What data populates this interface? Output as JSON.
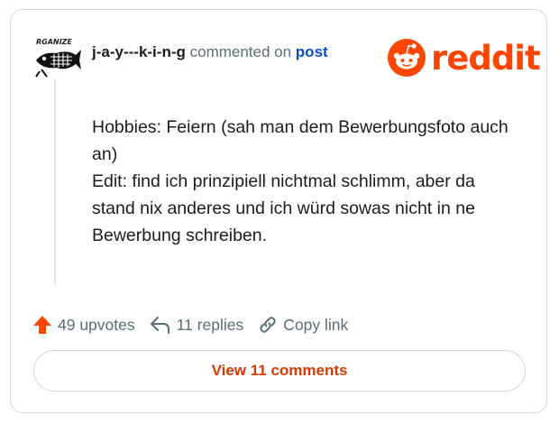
{
  "comment": {
    "avatar_text": "RGANIZE",
    "username": "j-a-y---k-i-n-g",
    "commented_on": "commented on",
    "post_link": "post",
    "lines": [
      "Hobbies: Feiern (sah man dem Bewerbungsfoto auch an)",
      "Edit: find ich prinzipiell nichtmal schlimm, aber da stand nix anderes und ich würd sowas nicht in ne Bewerbung schreiben."
    ]
  },
  "brand": {
    "logo_text": "reddit",
    "color": "#ff4500"
  },
  "actions": {
    "upvotes": "49 upvotes",
    "replies": "11 replies",
    "copy_link": "Copy link"
  },
  "view_button": "View 11 comments",
  "icons": {
    "upvote": "upvote-arrow-icon",
    "reply": "reply-arrow-icon",
    "link": "link-chain-icon",
    "logo": "reddit-snoo-icon"
  }
}
